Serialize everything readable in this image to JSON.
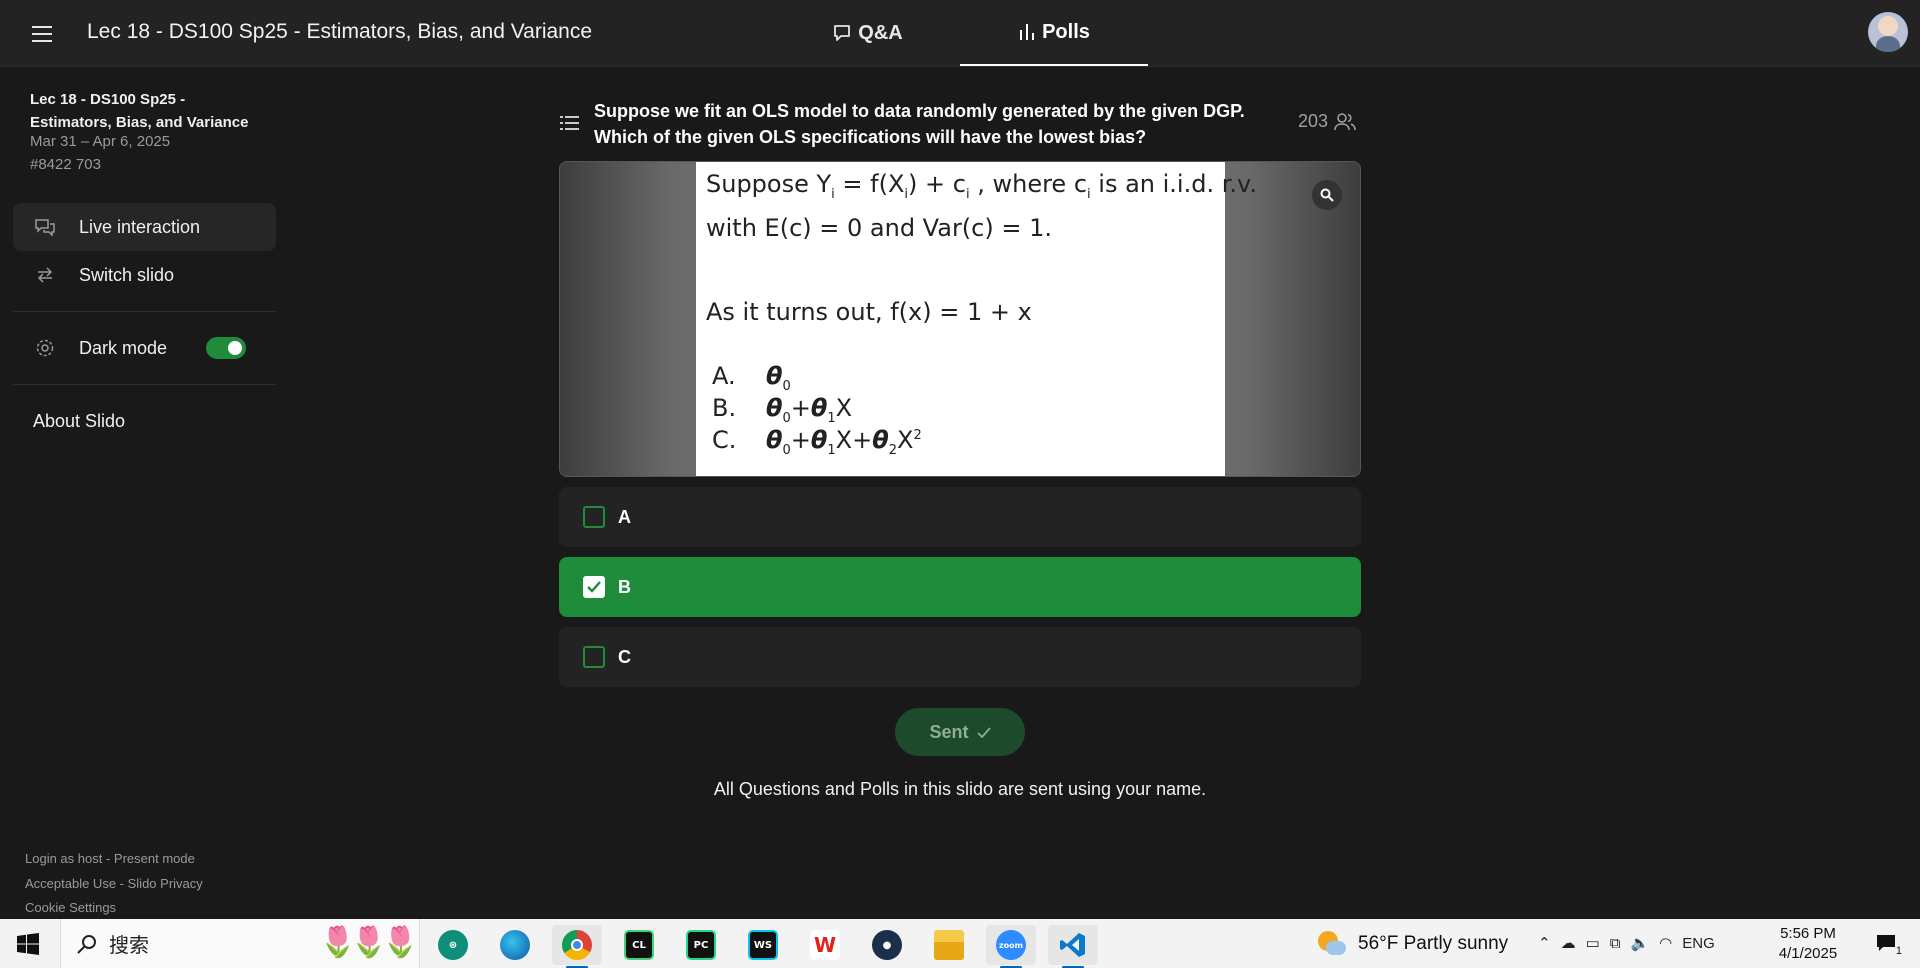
{
  "header": {
    "title": "Lec 18 - DS100 Sp25 - Estimators, Bias, and Variance",
    "tabs": [
      {
        "label": "Q&A"
      },
      {
        "label": "Polls"
      }
    ]
  },
  "sidebar": {
    "event_title": "Lec 18 - DS100 Sp25 - Estimators, Bias, and Variance",
    "dates": "Mar 31 – Apr 6, 2025",
    "code": "#8422 703",
    "items": [
      {
        "label": "Live interaction"
      },
      {
        "label": "Switch slido"
      },
      {
        "label": "Dark mode"
      }
    ],
    "dark_mode_on": true,
    "about": "About Slido",
    "footer": {
      "login": "Login as host",
      "sep1": " - ",
      "present": "Present mode",
      "acceptable": "Acceptable Use",
      "sep2": " - ",
      "privacy": "Slido Privacy",
      "cookie": "Cookie Settings"
    }
  },
  "poll": {
    "question": "Suppose we fit an OLS model to data randomly generated by the given DGP. Which of the given OLS specifications will have the lowest bias?",
    "participants": "203",
    "slide": {
      "line1_pre": "Suppose Y",
      "line1_sub_i1": "i",
      "line1_mid1": " = f(X",
      "line1_sub_i2": "i",
      "line1_mid2": ") + c",
      "line1_sub_i3": "i",
      "line1_mid3": " , where c",
      "line1_sub_i4": "i",
      "line1_end": " is an i.i.d. r.v.",
      "line2": "with E(c) = 0 and Var(c) = 1.",
      "line3": "As it turns out, f(x) = 1 + x",
      "options": [
        {
          "letter": "A.",
          "theta": "θ",
          "s0": "0",
          "rest": ""
        },
        {
          "letter": "B.",
          "theta": "θ",
          "s0": "0",
          "plus": "+",
          "theta1": "θ",
          "s1": "1",
          "x": "X"
        },
        {
          "letter": "C.",
          "theta": "θ",
          "s0": "0",
          "plus": "+",
          "theta1": "θ",
          "s1": "1",
          "x": "X",
          "plus2": "+",
          "theta2": "θ",
          "s2": "2",
          "x2": "X",
          "sup": "2"
        }
      ]
    },
    "choices": [
      {
        "label": "A",
        "selected": false
      },
      {
        "label": "B",
        "selected": true
      },
      {
        "label": "C",
        "selected": false
      }
    ],
    "sent_label": "Sent",
    "notice": "All Questions and Polls in this slido are sent using your name."
  },
  "taskbar": {
    "search_placeholder": "搜索",
    "apps": [
      "mindmap",
      "edge",
      "chrome",
      "clion",
      "pycharm",
      "webstorm",
      "wps",
      "steam",
      "file-explorer",
      "zoom",
      "vscode"
    ],
    "clion_label": "CL",
    "pycharm_label": "PC",
    "webstorm_label": "WS",
    "zoom_label": "zoom",
    "weather": "56°F  Partly sunny",
    "lang": "ENG",
    "time": "5:56 PM",
    "date": "4/1/2025",
    "notif_count": "1"
  },
  "colors": {
    "accent": "#1e8c3a",
    "background": "#191919",
    "panel": "#232323"
  }
}
